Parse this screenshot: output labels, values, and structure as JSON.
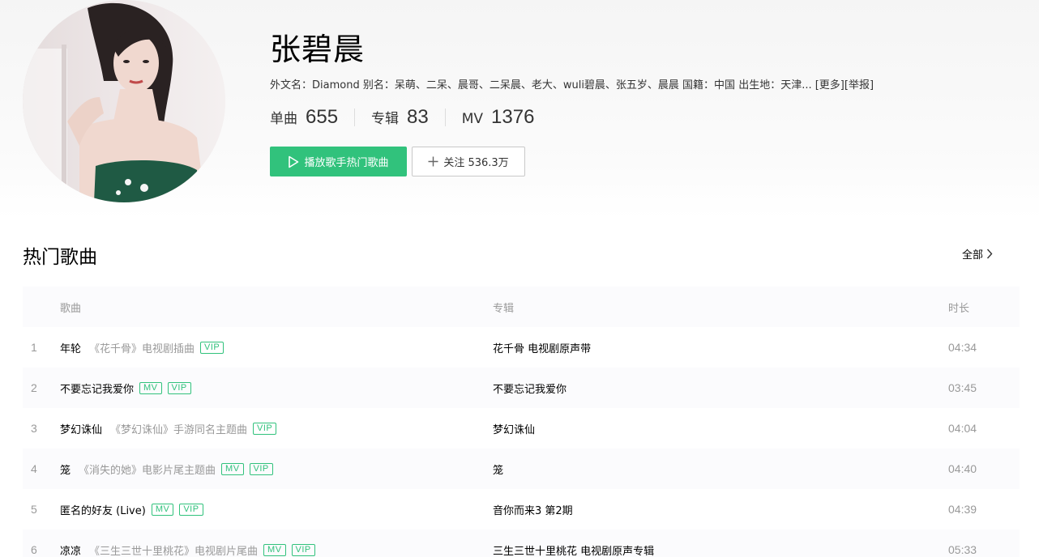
{
  "singer": {
    "name": "张碧晨",
    "info_prefix": "外文名：Diamond 别名：呆萌、二呆、晨哥、二呆晨、老大、wuli碧晨、张五岁、晨晨 国籍：中国 出生地：天津...",
    "more_link": "[更多]",
    "report_link": "[举报]"
  },
  "stats": {
    "single_label": "单曲",
    "single_value": "655",
    "album_label": "专辑",
    "album_value": "83",
    "mv_label": "MV",
    "mv_value": "1376"
  },
  "actions": {
    "play_label": "播放歌手热门歌曲",
    "follow_label": "关注 536.3万"
  },
  "section": {
    "title": "热门歌曲",
    "all_label": "全部"
  },
  "table": {
    "headers": {
      "song": "歌曲",
      "album": "专辑",
      "duration": "时长"
    },
    "rows": [
      {
        "index": "1",
        "name": "年轮",
        "desc": "《花千骨》电视剧插曲",
        "badges": [
          "VIP"
        ],
        "album": "花千骨 电视剧原声带",
        "duration": "04:34"
      },
      {
        "index": "2",
        "name": "不要忘记我爱你",
        "desc": "",
        "badges": [
          "MV",
          "VIP"
        ],
        "album": "不要忘记我爱你",
        "duration": "03:45"
      },
      {
        "index": "3",
        "name": "梦幻诛仙",
        "desc": "《梦幻诛仙》手游同名主题曲",
        "badges": [
          "VIP"
        ],
        "album": "梦幻诛仙",
        "duration": "04:04"
      },
      {
        "index": "4",
        "name": "笼",
        "desc": "《消失的她》电影片尾主题曲",
        "badges": [
          "MV",
          "VIP"
        ],
        "album": "笼",
        "duration": "04:40"
      },
      {
        "index": "5",
        "name": "匿名的好友 (Live)",
        "desc": "",
        "badges": [
          "MV",
          "VIP"
        ],
        "album": "音你而来3 第2期",
        "duration": "04:39"
      },
      {
        "index": "6",
        "name": "凉凉",
        "desc": "《三生三世十里桃花》电视剧片尾曲",
        "badges": [
          "MV",
          "VIP"
        ],
        "album": "三生三世十里桃花 电视剧原声专辑",
        "duration": "05:33"
      }
    ]
  },
  "colors": {
    "accent": "#31c27c",
    "muted": "#999999",
    "row_alt": "#fbfbfd"
  }
}
